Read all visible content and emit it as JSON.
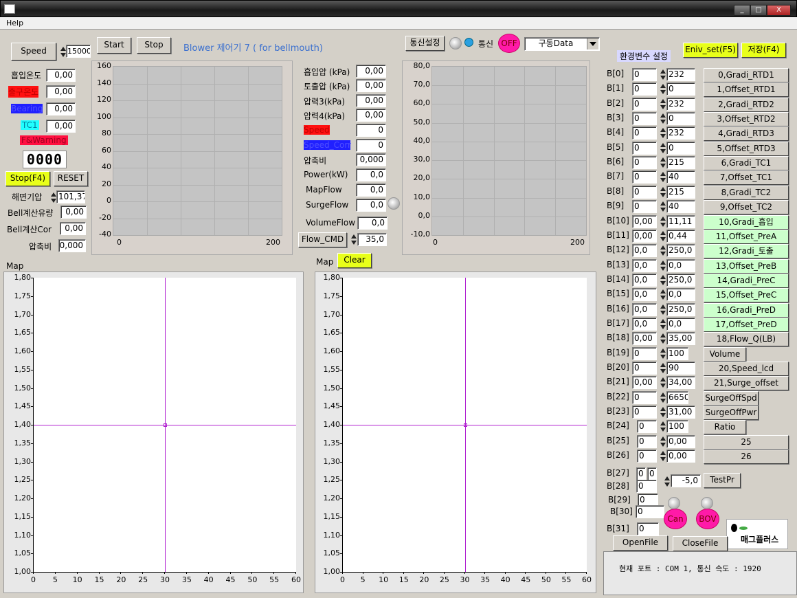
{
  "window": {
    "menu": [
      "Help"
    ],
    "min": "_",
    "max": "□",
    "close": "X"
  },
  "toolbar": {
    "speed_button": "Speed",
    "speed_value": "15000",
    "start": "Start",
    "stop": "Stop",
    "title": "Blower 제어기 7 ( for bellmouth)",
    "comm_settings": "통신설정",
    "comm_label": "통신",
    "comm_state": "OFF",
    "data_select": "구동Data"
  },
  "left": {
    "inlet_temp_label": "흡입온도",
    "inlet_temp": "0,00",
    "outlet_temp_label": "출구온도",
    "outlet_temp": "0,00",
    "bearing_label": "Bearing",
    "bearing": "0,00",
    "tc1_label": "TC1",
    "tc1": "0,00",
    "warning_label": "F&Warning",
    "warning_code": "0000",
    "stop_f4": "Stop(F4)",
    "reset": "RESET",
    "sea_pressure_label": "해면기압",
    "sea_pressure": "101,37",
    "bell_flow_label": "Bell계산유량",
    "bell_flow": "0,00",
    "bell_cor_label": "Bell계산Cor",
    "bell_cor": "0,00",
    "ratio_label": "압축비",
    "ratio": "0,000"
  },
  "middle": {
    "rows": [
      {
        "label": "흡입압 (kPa)",
        "value": "0,00"
      },
      {
        "label": "토출압 (kPa)",
        "value": "0,00"
      },
      {
        "label": "압력3(kPa)",
        "value": "0,00"
      },
      {
        "label": "압력4(kPa)",
        "value": "0,00"
      },
      {
        "label": "Speed",
        "value": "0"
      },
      {
        "label": "Speed_Corr",
        "value": "0"
      },
      {
        "label": "압축비",
        "value": "0,000"
      },
      {
        "label": "Power(kW)",
        "value": "0,0"
      },
      {
        "label": "MapFlow",
        "value": "0,0"
      },
      {
        "label": "SurgeFlow",
        "value": "0,0"
      },
      {
        "label": "VolumeFlow",
        "value": "0,0"
      }
    ],
    "flow_cmd": "Flow_CMD",
    "flow_cmd_value": "35,0"
  },
  "maps": {
    "left_label": "Map",
    "right_label": "Map",
    "clear": "Clear"
  },
  "colors": {
    "red_label": "#ff1010",
    "blue_label": "#2020ff",
    "cyan_label": "#20ffff",
    "warn": "#ff1040",
    "yellow_btn": "#e8ff1a",
    "green_btn": "#ccffcc",
    "crosshair": "#b020d0",
    "pink": "#ff1aa8"
  },
  "chart_data": [
    {
      "type": "line",
      "ylim": [
        -40,
        160
      ],
      "yticks": [
        "160",
        "140",
        "120",
        "100",
        "80",
        "60",
        "40",
        "20",
        "0",
        "-20",
        "-40"
      ],
      "xlim": [
        0,
        200
      ],
      "xticks": [
        "0",
        "200"
      ],
      "grid": true,
      "series": []
    },
    {
      "type": "line",
      "ylim": [
        -10,
        80
      ],
      "yticks": [
        "80,0",
        "70,0",
        "60,0",
        "50,0",
        "40,0",
        "30,0",
        "20,0",
        "10,0",
        "0,0",
        "-10,0"
      ],
      "xlim": [
        0,
        200
      ],
      "xticks": [
        "0",
        "200"
      ],
      "grid": true,
      "series": []
    },
    {
      "type": "scatter",
      "ylim": [
        1.0,
        1.8
      ],
      "yticks": [
        "1,80",
        "1,75",
        "1,70",
        "1,65",
        "1,60",
        "1,55",
        "1,50",
        "1,45",
        "1,40",
        "1,35",
        "1,30",
        "1,25",
        "1,20",
        "1,15",
        "1,10",
        "1,05",
        "1,00"
      ],
      "xlim": [
        0,
        60
      ],
      "xticks": [
        "0",
        "5",
        "10",
        "15",
        "20",
        "25",
        "30",
        "35",
        "40",
        "45",
        "50",
        "55",
        "60"
      ],
      "cursor": {
        "x": 30,
        "y": 1.4
      },
      "grid": false
    },
    {
      "type": "scatter",
      "ylim": [
        1.0,
        1.8
      ],
      "yticks": [
        "1,80",
        "1,75",
        "1,70",
        "1,65",
        "1,60",
        "1,55",
        "1,50",
        "1,45",
        "1,40",
        "1,35",
        "1,30",
        "1,25",
        "1,20",
        "1,15",
        "1,10",
        "1,05",
        "1,00"
      ],
      "xlim": [
        0,
        60
      ],
      "xticks": [
        "0",
        "5",
        "10",
        "15",
        "20",
        "25",
        "30",
        "35",
        "40",
        "45",
        "50",
        "55",
        "60"
      ],
      "cursor": {
        "x": 30,
        "y": 1.4
      },
      "grid": false
    }
  ],
  "env": {
    "title": "환경변수 설정",
    "env_set": "Eniv_set(F5)",
    "save": "저장(F4)",
    "rows": [
      {
        "label": "B[0]",
        "a": "0",
        "b": "232",
        "button": "0,Gradi_RTD1"
      },
      {
        "label": "B[1]",
        "a": "0",
        "b": "0",
        "button": "1,Offset_RTD1"
      },
      {
        "label": "B[2]",
        "a": "0",
        "b": "232",
        "button": "2,Gradi_RTD2"
      },
      {
        "label": "B[3]",
        "a": "0",
        "b": "0",
        "button": "3,Offset_RTD2"
      },
      {
        "label": "B[4]",
        "a": "0",
        "b": "232",
        "button": "4,Gradi_RTD3"
      },
      {
        "label": "B[5]",
        "a": "0",
        "b": "0",
        "button": "5,Offset_RTD3"
      },
      {
        "label": "B[6]",
        "a": "0",
        "b": "215",
        "button": "6,Gradi_TC1"
      },
      {
        "label": "B[7]",
        "a": "0",
        "b": "40",
        "button": "7,Offset_TC1"
      },
      {
        "label": "B[8]",
        "a": "0",
        "b": "215",
        "button": "8,Gradi_TC2"
      },
      {
        "label": "B[9]",
        "a": "0",
        "b": "40",
        "button": "9,Offset_TC2"
      },
      {
        "label": "B[10]",
        "a": "0,00",
        "b": "11,11",
        "button": "10,Gradi_흡입",
        "highlight": true
      },
      {
        "label": "B[11]",
        "a": "0,00",
        "b": "0,44",
        "button": "11,Offset_PreA",
        "highlight": true
      },
      {
        "label": "B[12]",
        "a": "0,0",
        "b": "250,0",
        "button": "12,Gradi_토출",
        "highlight": true
      },
      {
        "label": "B[13]",
        "a": "0,0",
        "b": "0,0",
        "button": "13,Offset_PreB",
        "highlight": true
      },
      {
        "label": "B[14]",
        "a": "0,0",
        "b": "250,0",
        "button": "14,Gradi_PreC",
        "highlight": true
      },
      {
        "label": "B[15]",
        "a": "0,0",
        "b": "0,0",
        "button": "15,Offset_PreC",
        "highlight": true
      },
      {
        "label": "B[16]",
        "a": "0,0",
        "b": "250,0",
        "button": "16,Gradi_PreD",
        "highlight": true
      },
      {
        "label": "B[17]",
        "a": "0,0",
        "b": "0,0",
        "button": "17,Offset_PreD",
        "highlight": true
      },
      {
        "label": "B[18]",
        "a": "0,00",
        "b": "35,00",
        "button": "18,Flow_Q(LB)"
      },
      {
        "label": "B[19]",
        "a": "0",
        "b": "100",
        "button": "Volume"
      },
      {
        "label": "B[20]",
        "a": "0",
        "b": "90",
        "button": "20,Speed_lcd"
      },
      {
        "label": "B[21]",
        "a": "0,00",
        "b": "34,00",
        "button": "21,Surge_offset"
      },
      {
        "label": "B[22]",
        "a": "0",
        "b": "6650",
        "button": "SurgeOffSpd"
      },
      {
        "label": "B[23]",
        "a": "0",
        "b": "31,00",
        "button": "SurgeOffPwr"
      },
      {
        "label": "B[24]",
        "a": "0",
        "b": "100",
        "button": "Ratio"
      },
      {
        "label": "B[25]",
        "a": "0",
        "b": "0,00",
        "button": "25"
      },
      {
        "label": "B[26]",
        "a": "0",
        "b": "0,00",
        "button": "26"
      }
    ],
    "b27_label": "B[27]",
    "b27_a": "0",
    "b27_b": "0",
    "b28_label": "B[28]",
    "b28": "0",
    "test_value": "-5,0",
    "test_pr": "TestPr",
    "b29_label": "B[29]",
    "b29": "0",
    "b30_label": "B[30]",
    "b30": "0",
    "b31_label": "B[31]",
    "b31": "0",
    "can": "Can",
    "bov": "BOV",
    "logo": "매그플러스",
    "open_file": "OpenFile",
    "close_file": "CloseFile",
    "status": "현재 포트 : COM 1,  통신 속도 : 1920"
  }
}
